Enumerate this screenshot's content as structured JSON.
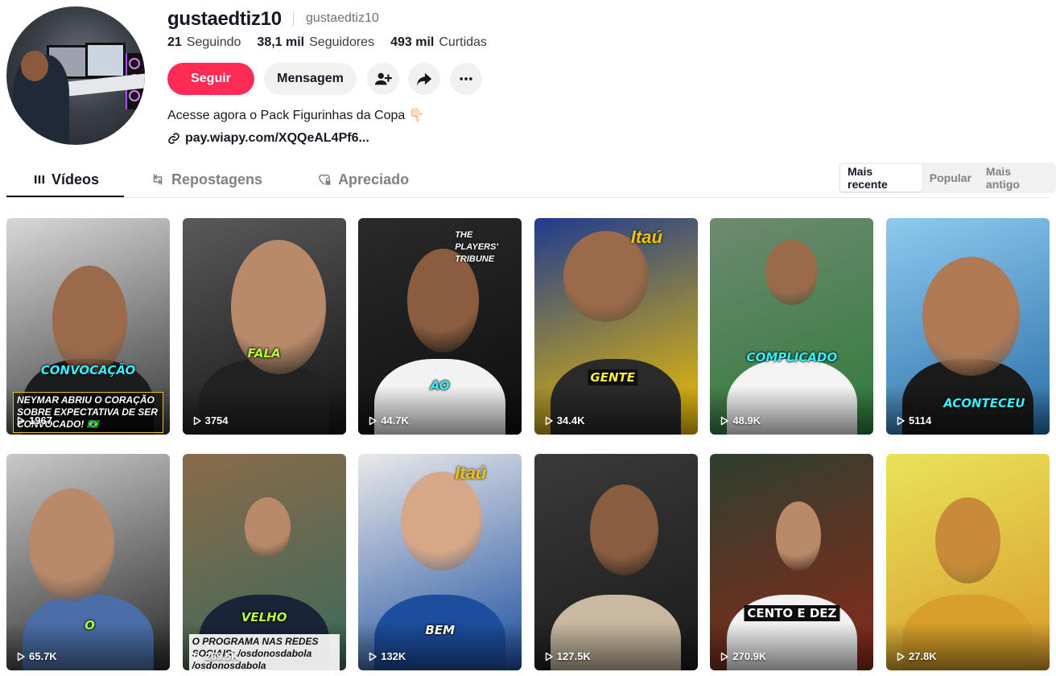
{
  "profile": {
    "username": "gustaedtiz10",
    "nickname": "gustaedtiz10",
    "stats": [
      {
        "value": "21",
        "label": "Seguindo"
      },
      {
        "value": "38,1 mil",
        "label": "Seguidores"
      },
      {
        "value": "493 mil",
        "label": "Curtidas"
      }
    ],
    "follow_label": "Seguir",
    "message_label": "Mensagem",
    "bio": "Acesse agora o Pack Figurinhas da Copa 👇🏻",
    "link": "pay.wiapy.com/XQQeAL4Pf6..."
  },
  "tabs": [
    {
      "label": "Vídeos",
      "icon": "grid-icon"
    },
    {
      "label": "Repostagens",
      "icon": "repost-icon"
    },
    {
      "label": "Apreciado",
      "icon": "heart-lock-icon"
    }
  ],
  "sort": [
    "Mais recente",
    "Popular",
    "Mais antigo"
  ],
  "videos": [
    {
      "views": "1967",
      "caption": "CONVOCAÇÃO",
      "overlay": "NEYMAR ABRIU O CORAÇÃO SOBRE EXPECTATIVA DE SER CONVOCADO! 🇧🇷",
      "bg1": "#d8d8d8",
      "bg2": "#3a3a3a",
      "skin": "#9a6a4a",
      "shirt": "#1c1c1c",
      "cap_color": "#35f0ff"
    },
    {
      "views": "3754",
      "caption": "FALA",
      "overlay": "",
      "bg1": "#5a5a5a",
      "bg2": "#141414",
      "skin": "#b98a6a",
      "shirt": "#222222",
      "cap_color": "#b6ff3b"
    },
    {
      "views": "44.7K",
      "caption": "AO",
      "overlay": "THE PLAYERS' TRIBUNE",
      "bg1": "#2a2a2a",
      "bg2": "#0e0e0e",
      "skin": "#8a5d3f",
      "shirt": "#f2f2f2",
      "cap_color": "#35f0ff"
    },
    {
      "views": "34.4K",
      "caption": "GENTE",
      "overlay": "Itaú",
      "bg1": "#1f3b8f",
      "bg2": "#f2c200",
      "skin": "#9a6a4a",
      "shirt": "#2a2a2a",
      "cap_color": "#ffef3b"
    },
    {
      "views": "48.9K",
      "caption": "COMPLICADO",
      "overlay": "",
      "bg1": "#6e8a6e",
      "bg2": "#2f7a3c",
      "skin": "#9a6a4a",
      "shirt": "#f4f4f4",
      "cap_color": "#35f0ff"
    },
    {
      "views": "5114",
      "caption": "ACONTECEU",
      "overlay": "",
      "bg1": "#8fc9ee",
      "bg2": "#2a6fa8",
      "skin": "#b07a55",
      "shirt": "#1a1a1a",
      "cap_color": "#35f0ff"
    },
    {
      "views": "65.7K",
      "caption": "O",
      "overlay": "",
      "bg1": "#c9c9c9",
      "bg2": "#2b2b2b",
      "skin": "#b98a6a",
      "shirt": "#4a6fa8",
      "cap_color": "#b6ff3b"
    },
    {
      "views": "269.5K",
      "caption": "VELHO",
      "overlay": "O PROGRAMA NAS REDES SOCIAIS: /osdonosdabola /osdonosdabola",
      "bg1": "#8a6a4a",
      "bg2": "#3a6a5a",
      "skin": "#b98a6a",
      "shirt": "#1a2438",
      "cap_color": "#b6ff3b"
    },
    {
      "views": "132K",
      "caption": "BEM",
      "overlay": "Itaú",
      "bg1": "#e9e9e9",
      "bg2": "#1e4fa0",
      "skin": "#d6a888",
      "shirt": "#1d4e9e",
      "cap_color": "#ffffff"
    },
    {
      "views": "127.5K",
      "caption": "",
      "overlay": "",
      "bg1": "#3a3a3a",
      "bg2": "#1a1a1a",
      "skin": "#8a5d3f",
      "shirt": "#c8b9a0",
      "cap_color": "#ffffff"
    },
    {
      "views": "270.9K",
      "caption": "CENTO E DEZ",
      "overlay": "",
      "bg1": "#2e3f2e",
      "bg2": "#8a2a1a",
      "skin": "#b98a6a",
      "shirt": "#f2f2f2",
      "cap_color": "#ffffff"
    },
    {
      "views": "27.8K",
      "caption": "",
      "overlay": "",
      "bg1": "#e9e35a",
      "bg2": "#d89a2a",
      "skin": "#c98a3a",
      "shirt": "#d8a02a",
      "cap_color": "#ffffff"
    }
  ]
}
